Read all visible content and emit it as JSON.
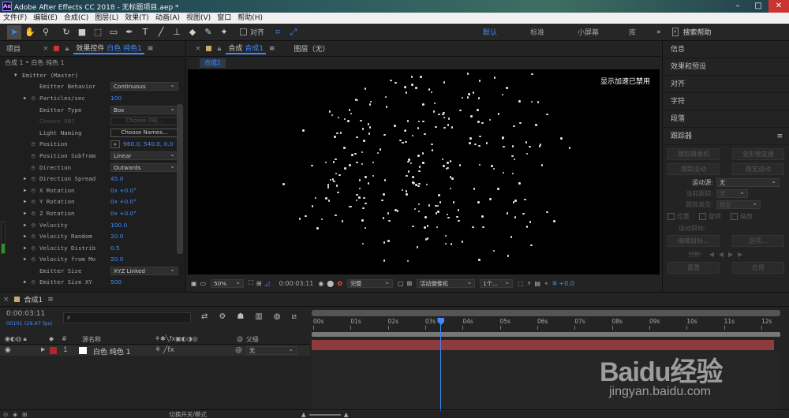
{
  "window": {
    "title": "Adobe After Effects CC 2018 - 无标题项目.aep *",
    "logo": "Ae",
    "controls": [
      "–",
      "□",
      "✕"
    ]
  },
  "menu": [
    "文件(F)",
    "编辑(E)",
    "合成(C)",
    "图层(L)",
    "效果(T)",
    "动画(A)",
    "视图(V)",
    "窗口",
    "帮助(H)"
  ],
  "toolbar": {
    "align_label": "对齐",
    "workspaces": [
      "默认",
      "标准",
      "小屏幕",
      "库"
    ],
    "more": "»",
    "search_placeholder": "搜索帮助"
  },
  "effects_panel": {
    "tab_project": "项目",
    "tab_effects": "效果控件",
    "tab_layer": "白色 纯色1",
    "breadcrumb": "合成 1 • 白色 纯色 1",
    "properties": [
      {
        "label": "Emitter (Master)",
        "indent": 1,
        "arrow": "▼",
        "type": "group"
      },
      {
        "label": "Emitter Behavior",
        "indent": 2,
        "type": "dropdown",
        "value": "Continuous"
      },
      {
        "label": "Particles/sec",
        "indent": 2,
        "arrow": "▶",
        "stopwatch": true,
        "type": "value",
        "value": "100"
      },
      {
        "label": "Emitter Type",
        "indent": 2,
        "type": "dropdown",
        "value": "Box"
      },
      {
        "label": "Choose OBJ",
        "indent": 2,
        "type": "disabled-button",
        "value": "Choose OBJ...",
        "disabled": true
      },
      {
        "label": "Light Naming",
        "indent": 2,
        "type": "button",
        "value": "Choose Names..."
      },
      {
        "label": "Position",
        "indent": 2,
        "stopwatch": true,
        "type": "point",
        "value": "960.0, 540.0, 0.0"
      },
      {
        "label": "Position Subfram",
        "indent": 2,
        "stopwatch": true,
        "type": "dropdown",
        "value": "Linear"
      },
      {
        "label": "Direction",
        "indent": 2,
        "stopwatch": true,
        "type": "dropdown",
        "value": "Outwards"
      },
      {
        "label": "Direction Spread",
        "indent": 2,
        "arrow": "▶",
        "stopwatch": true,
        "type": "value",
        "value": "45.0"
      },
      {
        "label": "X Rotation",
        "indent": 2,
        "arrow": "▶",
        "stopwatch": true,
        "type": "value",
        "value": "0x +0.0°"
      },
      {
        "label": "Y Rotation",
        "indent": 2,
        "arrow": "▶",
        "stopwatch": true,
        "type": "value",
        "value": "0x +0.0°"
      },
      {
        "label": "Z Rotation",
        "indent": 2,
        "arrow": "▶",
        "stopwatch": true,
        "type": "value",
        "value": "0x +0.0°"
      },
      {
        "label": "Velocity",
        "indent": 2,
        "arrow": "▶",
        "stopwatch": true,
        "type": "value",
        "value": "100.0"
      },
      {
        "label": "Velocity Random",
        "indent": 2,
        "arrow": "▶",
        "stopwatch": true,
        "type": "value",
        "value": "20.0"
      },
      {
        "label": "Velocity Distrib",
        "indent": 2,
        "arrow": "▶",
        "stopwatch": true,
        "type": "value",
        "value": "0.5"
      },
      {
        "label": "Velocity from Mo",
        "indent": 2,
        "arrow": "▶",
        "stopwatch": true,
        "type": "value",
        "value": "20.0"
      },
      {
        "label": "Emitter Size",
        "indent": 2,
        "type": "dropdown",
        "value": "XYZ Linked"
      },
      {
        "label": "Emitter Size XY",
        "indent": 2,
        "arrow": "▶",
        "stopwatch": true,
        "type": "value",
        "value": "500"
      }
    ]
  },
  "comp_panel": {
    "tab_comp_prefix": "合成",
    "tab_comp": "合成1",
    "tab_layer": "图层（无）",
    "subtab": "合成1",
    "notice": "显示加速已禁用",
    "zoom": "50%",
    "timecode": "0:00:03:11",
    "resolution": "完整",
    "camera": "活动摄像机",
    "views": "1个...",
    "exposure": "+0.0"
  },
  "right_panels": {
    "items": [
      "信息",
      "效果和预设",
      "对齐",
      "字符",
      "段落"
    ],
    "tracker": {
      "title": "跟踪器",
      "buttons": [
        "跟踪摄像机",
        "变形稳定器",
        "跟踪运动",
        "稳定运动"
      ],
      "motion_source_label": "运动源:",
      "motion_source_value": "无",
      "current_track_label": "当前跟踪:",
      "current_track_value": "无",
      "track_type_label": "跟踪类型:",
      "track_type_value": "稳定",
      "checks": [
        "位置",
        "旋转",
        "缩放"
      ],
      "motion_target_label": "运动目标:",
      "edit_target": "编辑目标...",
      "options": "选项...",
      "analyze_label": "分析:",
      "reset": "重置",
      "apply": "应用"
    }
  },
  "timeline": {
    "comp_tab": "合成1",
    "timecode": "0:00:03:11",
    "frames": "00101 (29.97 fps)",
    "search_placeholder": "",
    "col_source": "源名称",
    "col_parent": "父级",
    "ruler": [
      "00s",
      "01s",
      "02s",
      "03s",
      "04s",
      "05s",
      "06s",
      "07s",
      "08s",
      "09s",
      "10s",
      "11s",
      "12s"
    ],
    "playhead_fraction": 0.2718,
    "layer": {
      "index": "1",
      "name": "白色 纯色 1",
      "parent": "无",
      "color": "#b5242a"
    },
    "bottom": "切换开关/模式"
  },
  "colors": {
    "accent": "#3d8bff",
    "layer_bar": "#8f3a3c",
    "label_red": "#b5242a"
  },
  "watermark": {
    "main": "Baidu经验",
    "sub": "jingyan.baidu.com"
  }
}
